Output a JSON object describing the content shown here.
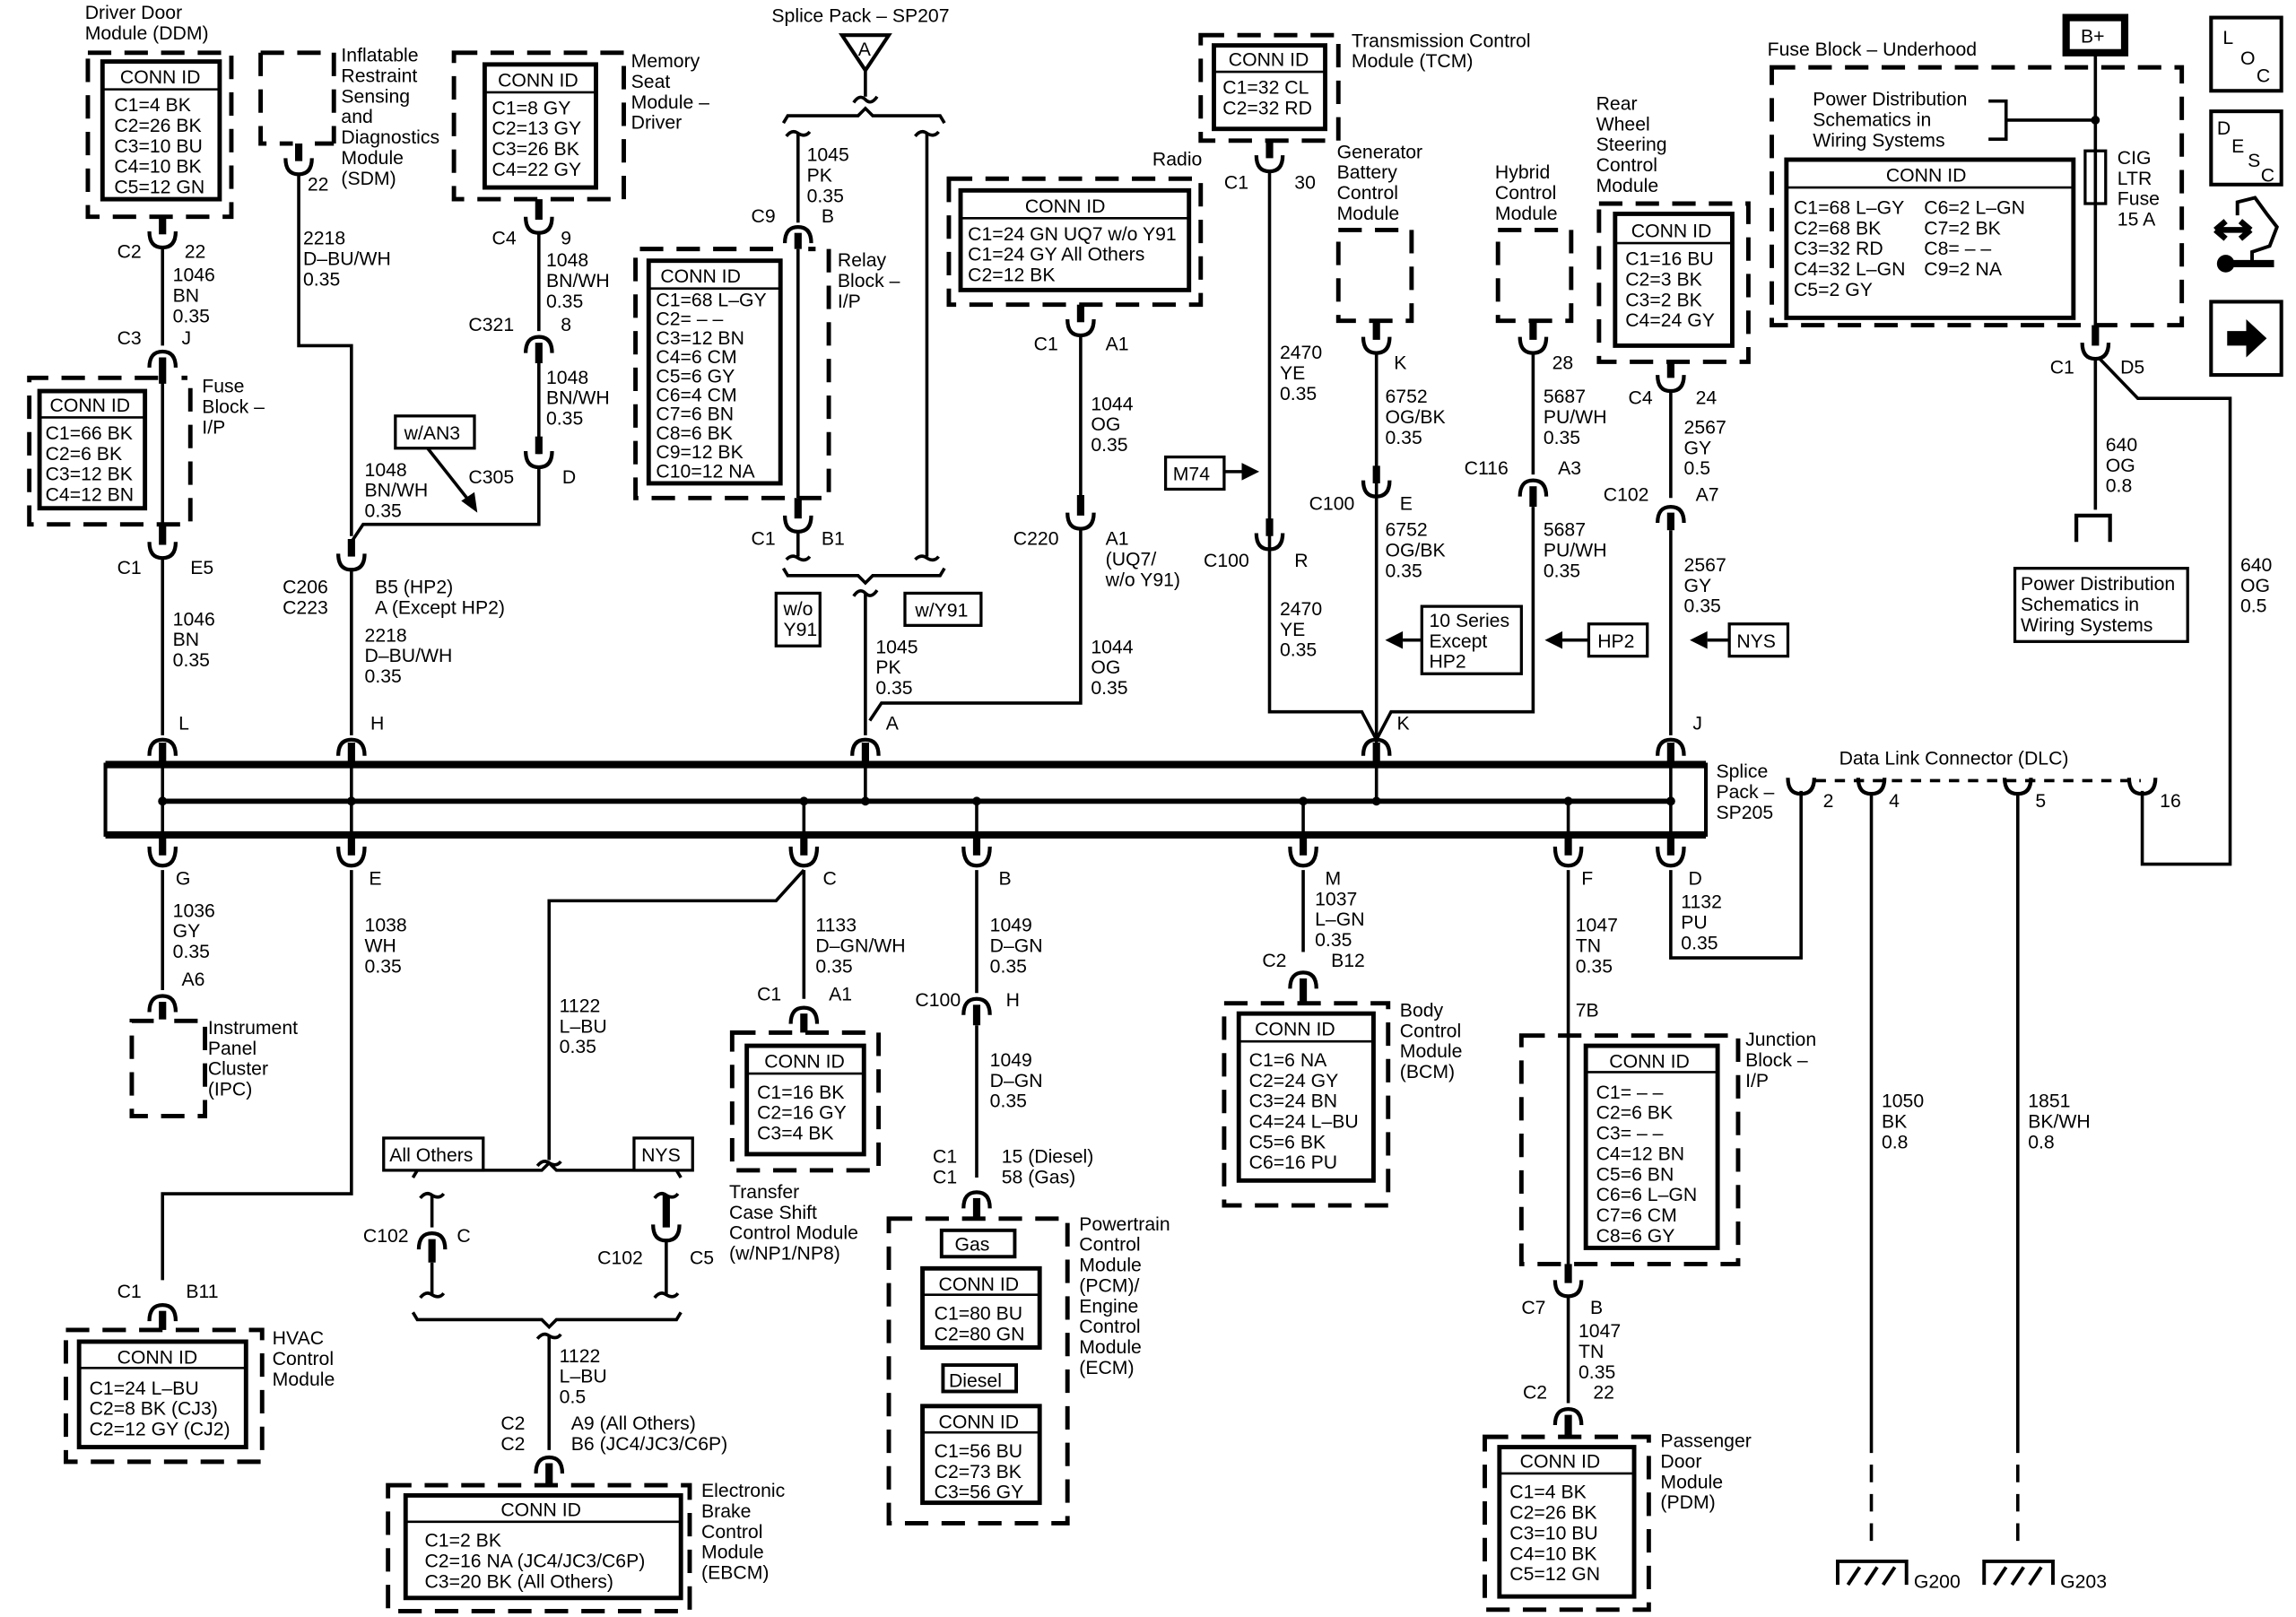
{
  "diagram": {
    "type": "automotive wiring schematic",
    "modules": {
      "ddm": {
        "name": [
          "Driver Door",
          "Module (DDM)"
        ],
        "conn_header": "CONN ID",
        "conns": [
          "C1=4 BK",
          "C2=26 BK",
          "C3=10 BU",
          "C4=10 BK",
          "C5=12 GN"
        ]
      },
      "sdm": {
        "name": [
          "Inflatable",
          "Restraint",
          "Sensing",
          "and",
          "Diagnostics",
          "Module",
          "(SDM)"
        ]
      },
      "msm": {
        "name": [
          "Memory",
          "Seat",
          "Module –",
          "Driver"
        ],
        "conn_header": "CONN ID",
        "conns": [
          "C1=8 GY",
          "C2=13 GY",
          "C3=26 BK",
          "C4=22 GY"
        ]
      },
      "sp207": {
        "name": "Splice Pack – SP207",
        "symbol": "A"
      },
      "relay": {
        "name": [
          "Relay",
          "Block –",
          "I/P"
        ],
        "conn_header": "CONN ID",
        "conns": [
          "C1=68 L–GY",
          "C2= – –",
          "C3=12 BN",
          "C4=6 CM",
          "C5=6 GY",
          "C6=4 CM",
          "C7=6 BN",
          "C8=6 BK",
          "C9=12 BK",
          "C10=12 NA"
        ]
      },
      "radio": {
        "name": "Radio",
        "conn_header": "CONN ID",
        "conns": [
          "C1=24 GN UQ7 w/o Y91",
          "C1=24 GY All Others",
          "C2=12 BK"
        ]
      },
      "tcm": {
        "name": [
          "Transmission Control",
          "Module (TCM)"
        ],
        "conn_header": "CONN ID",
        "conns": [
          "C1=32 CL",
          "C2=32 RD"
        ]
      },
      "gbcm": {
        "name": [
          "Generator",
          "Battery",
          "Control",
          "Module"
        ]
      },
      "hcm": {
        "name": [
          "Hybrid",
          "Control",
          "Module"
        ]
      },
      "rwsc": {
        "name": [
          "Rear",
          "Wheel",
          "Steering",
          "Control",
          "Module"
        ],
        "conn_header": "CONN ID",
        "conns": [
          "C1=16 BU",
          "C2=3 BK",
          "C3=2 BK",
          "C4=24 GY"
        ]
      },
      "fbu": {
        "name": "Fuse Block – Underhood",
        "pd_ref": [
          "Power Distribution",
          "Schematics in",
          "Wiring Systems"
        ],
        "conn_header": "CONN ID",
        "conns_left": [
          "C1=68 L–GY",
          "C2=68 BK",
          "C3=32 RD",
          "C4=32 L–GN",
          "C5=2 GY"
        ],
        "conns_right": [
          "C6=2 L–GN",
          "C7=2 BK",
          "C8= – –",
          "C9=2 NA"
        ],
        "fuse": [
          "CIG",
          "LTR",
          "Fuse",
          "15 A"
        ]
      },
      "bplus": "B+",
      "fbip": {
        "name": [
          "Fuse",
          "Block –",
          "I/P"
        ],
        "conn_header": "CONN ID",
        "conns": [
          "C1=66 BK",
          "C2=6 BK",
          "C3=12 BK",
          "C4=12 BN"
        ]
      },
      "sp205": {
        "name": [
          "Splice",
          "Pack –",
          "SP205"
        ]
      },
      "dlc": {
        "name": "Data Link Connector (DLC)",
        "pins": [
          "2",
          "4",
          "5",
          "16"
        ]
      },
      "ipc": {
        "name": [
          "Instrument",
          "Panel",
          "Cluster",
          "(IPC)"
        ]
      },
      "hvac": {
        "name": [
          "HVAC",
          "Control",
          "Module"
        ],
        "conn_header": "CONN ID",
        "conns": [
          "C1=24 L–BU",
          "C2=8 BK (CJ3)",
          "C2=12 GY (CJ2)"
        ]
      },
      "ebcm": {
        "name": [
          "Electronic",
          "Brake",
          "Control",
          "Module",
          "(EBCM)"
        ],
        "conn_header": "CONN ID",
        "conns": [
          "C1=2 BK",
          "C2=16 NA (JC4/JC3/C6P)",
          "C3=20 BK (All Others)"
        ]
      },
      "tcsm": {
        "name": [
          "Transfer",
          "Case Shift",
          "Control Module",
          "(w/NP1/NP8)"
        ],
        "conn_header": "CONN ID",
        "conns": [
          "C1=16 BK",
          "C2=16 GY",
          "C3=4 BK"
        ]
      },
      "pcm": {
        "name": [
          "Powertrain",
          "Control",
          "Module",
          "(PCM)/",
          "Engine",
          "Control",
          "Module",
          "(ECM)"
        ],
        "gas_label": "Gas",
        "diesel_label": "Diesel",
        "conn_header": "CONN ID",
        "gas_conns": [
          "C1=80 BU",
          "C2=80 GN"
        ],
        "diesel_conns": [
          "C1=56 BU",
          "C2=73 BK",
          "C3=56 GY"
        ]
      },
      "bcm": {
        "name": [
          "Body",
          "Control",
          "Module",
          "(BCM)"
        ],
        "conn_header": "CONN ID",
        "conns": [
          "C1=6 NA",
          "C2=24 GY",
          "C3=24 BN",
          "C4=24 L–BU",
          "C5=6 BK",
          "C6=16 PU"
        ]
      },
      "jbip": {
        "name": [
          "Junction",
          "Block –",
          "I/P"
        ],
        "conn_header": "CONN ID",
        "conns": [
          "C1= – –",
          "C2=6 BK",
          "C3= – –",
          "C4=12 BN",
          "C5=6 BN",
          "C6=6 L–GN",
          "C7=6 CM",
          "C8=6 GY"
        ]
      },
      "pdm": {
        "name": [
          "Passenger",
          "Door",
          "Module",
          "(PDM)"
        ],
        "conn_header": "CONN ID",
        "conns": [
          "C1=4 BK",
          "C2=26 BK",
          "C3=10 BU",
          "C4=10 BK",
          "C5=12 GN"
        ]
      },
      "pd_box": [
        "Power Distribution",
        "Schematics in",
        "Wiring Systems"
      ],
      "grounds": [
        "G200",
        "G203"
      ]
    },
    "options": {
      "wan3": "w/AN3",
      "m74": "M74",
      "series10": [
        "10 Series",
        "Except",
        "HP2"
      ],
      "hp2": "HP2",
      "nys": "NYS",
      "woy91": [
        "w/o",
        "Y91"
      ],
      "wy91": "w/Y91",
      "allothers": "All Others",
      "nys2": "NYS"
    },
    "wires": {
      "ddm_c2": {
        "conn": "C2",
        "pin": "22",
        "circuit": [
          "1046",
          "BN",
          "0.35"
        ]
      },
      "c3j": {
        "conn": "C3",
        "pin": "J"
      },
      "fbip_c1": {
        "conn": "C1",
        "pin": "E5",
        "circuit": [
          "1046",
          "BN",
          "0.35"
        ],
        "splice": "L"
      },
      "sdm": {
        "pin": "22",
        "circuit": [
          "2218",
          "D–BU/WH",
          "0.35"
        ]
      },
      "c206": {
        "conn": [
          "C206",
          "C223"
        ],
        "pin": [
          "B5 (HP2)",
          "A (Except HP2)"
        ],
        "circuit": [
          "2218",
          "D–BU/WH",
          "0.35"
        ],
        "splice": "H"
      },
      "msm_c4": {
        "conn": "C4",
        "pin": "9",
        "circuit": [
          "1048",
          "BN/WH",
          "0.35"
        ]
      },
      "c321": {
        "conn": "C321",
        "pin": "8",
        "circuit": [
          "1048",
          "BN/WH",
          "0.35"
        ]
      },
      "c305": {
        "conn": "C305",
        "pin": "D",
        "circuit": [
          "1048",
          "BN/WH",
          "0.35"
        ]
      },
      "relay_c9": {
        "conn": "C9",
        "pin": "B",
        "circuit": [
          "1045",
          "PK",
          "0.35"
        ]
      },
      "relay_c1": {
        "conn": "C1",
        "pin": "B1"
      },
      "sp207_out": {
        "circuit": [
          "1045",
          "PK",
          "0.35"
        ],
        "splice": "A"
      },
      "radio_c1": {
        "conn": "C1",
        "pin": "A1",
        "circuit": [
          "1044",
          "OG",
          "0.35"
        ]
      },
      "c220": {
        "conn": "C220",
        "pin": [
          "A1",
          "(UQ7/",
          "w/o Y91)"
        ],
        "circuit": [
          "1044",
          "OG",
          "0.35"
        ]
      },
      "tcm_c1": {
        "conn": "C1",
        "pin": "30",
        "circuit": [
          "2470",
          "YE",
          "0.35"
        ]
      },
      "c100r": {
        "conn": "C100",
        "pin": "R",
        "circuit": [
          "2470",
          "YE",
          "0.35"
        ]
      },
      "gbcm": {
        "pin": "K",
        "circuit": [
          "6752",
          "OG/BK",
          "0.35"
        ]
      },
      "c100e": {
        "conn": "C100",
        "pin": "E",
        "circuit": [
          "6752",
          "OG/BK",
          "0.35"
        ]
      },
      "hcm": {
        "pin": "28",
        "circuit": [
          "5687",
          "PU/WH",
          "0.35"
        ]
      },
      "c116": {
        "conn": "C116",
        "pin": "A3",
        "circuit": [
          "5687",
          "PU/WH",
          "0.35"
        ]
      },
      "splice_k": "K",
      "rwsc_c4": {
        "conn": "C4",
        "pin": "24",
        "circuit": [
          "2567",
          "GY",
          "0.5"
        ]
      },
      "c102a7": {
        "conn": "C102",
        "pin": "A7",
        "circuit": [
          "2567",
          "GY",
          "0.35"
        ],
        "splice": "J"
      },
      "fbu_c1": {
        "conn": "C1",
        "pin": "D5",
        "circuit_a": [
          "640",
          "OG",
          "0.8"
        ],
        "circuit_b": [
          "640",
          "OG",
          "0.5"
        ]
      },
      "g": {
        "splice": "G",
        "circuit": [
          "1036",
          "GY",
          "0.35"
        ],
        "pin": "A6"
      },
      "e": {
        "splice": "E",
        "circuit": [
          "1038",
          "WH",
          "0.35"
        ],
        "conn": "C1",
        "pin": "B11"
      },
      "c": {
        "splice": "C",
        "circuit": [
          "1133",
          "D–GN/WH",
          "0.35"
        ],
        "conn": "C1",
        "pin": "A1",
        "circuit_b": [
          "1122",
          "L–BU",
          "0.35"
        ]
      },
      "c102c": {
        "conn": "C102",
        "pin": "C"
      },
      "c102c5": {
        "conn": "C102",
        "pin": "C5"
      },
      "ebcm_c2": {
        "circuit": [
          "1122",
          "L–BU",
          "0.5"
        ],
        "conn": [
          "C2",
          "C2"
        ],
        "pin": [
          "A9 (All Others)",
          "B6 (JC4/JC3/C6P)"
        ]
      },
      "b": {
        "splice": "B",
        "circuit": [
          "1049",
          "D–GN",
          "0.35"
        ],
        "conn": "C100",
        "pin": "H",
        "circuit_b": [
          "1049",
          "D–GN",
          "0.35"
        ],
        "conn_b": [
          "C1",
          "C1"
        ],
        "pin_b": [
          "15 (Diesel)",
          "58 (Gas)"
        ]
      },
      "m": {
        "splice": "M",
        "circuit": [
          "1037",
          "L–GN",
          "0.35"
        ],
        "conn": "C2",
        "pin": "B12"
      },
      "f": {
        "splice": "F",
        "circuit": [
          "1047",
          "TN",
          "0.35"
        ],
        "pin": "7B",
        "conn_b": "C7",
        "pin_b": "B",
        "circuit_b": [
          "1047",
          "TN",
          "0.35"
        ],
        "conn_c": "C2",
        "pin_c": "22"
      },
      "d": {
        "splice": "D",
        "circuit": [
          "1132",
          "PU",
          "0.35"
        ]
      },
      "dlc4": {
        "circuit": [
          "1050",
          "BK",
          "0.8"
        ]
      },
      "dlc5": {
        "circuit": [
          "1851",
          "BK/WH",
          "0.8"
        ]
      }
    },
    "side_icons": {
      "loc": [
        "L",
        "O",
        "C"
      ],
      "desc": [
        "D",
        "E",
        "S",
        "C"
      ]
    }
  }
}
